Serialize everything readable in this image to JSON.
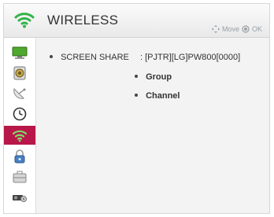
{
  "header": {
    "title": "WIRELESS",
    "hint": {
      "move_label": "Move",
      "ok_label": "OK"
    },
    "icon": "wifi-icon"
  },
  "sidebar": {
    "items": [
      {
        "icon": "monitor-icon",
        "active": false
      },
      {
        "icon": "speaker-icon",
        "active": false
      },
      {
        "icon": "satellite-dish-icon",
        "active": false
      },
      {
        "icon": "clock-icon",
        "active": false
      },
      {
        "icon": "wifi-icon",
        "active": true
      },
      {
        "icon": "lock-icon",
        "active": false
      },
      {
        "icon": "briefcase-icon",
        "active": false
      },
      {
        "icon": "projector-settings-icon",
        "active": false
      }
    ]
  },
  "main": {
    "screen_share": {
      "label": "SCREEN SHARE",
      "value": ": [PJTR][LG]PW800[0000]"
    },
    "options": [
      {
        "label": "Group"
      },
      {
        "label": "Channel"
      }
    ]
  },
  "colors": {
    "accent": "#b8174a",
    "wifi_green": "#34b34a",
    "background": "#f3f3f3"
  }
}
